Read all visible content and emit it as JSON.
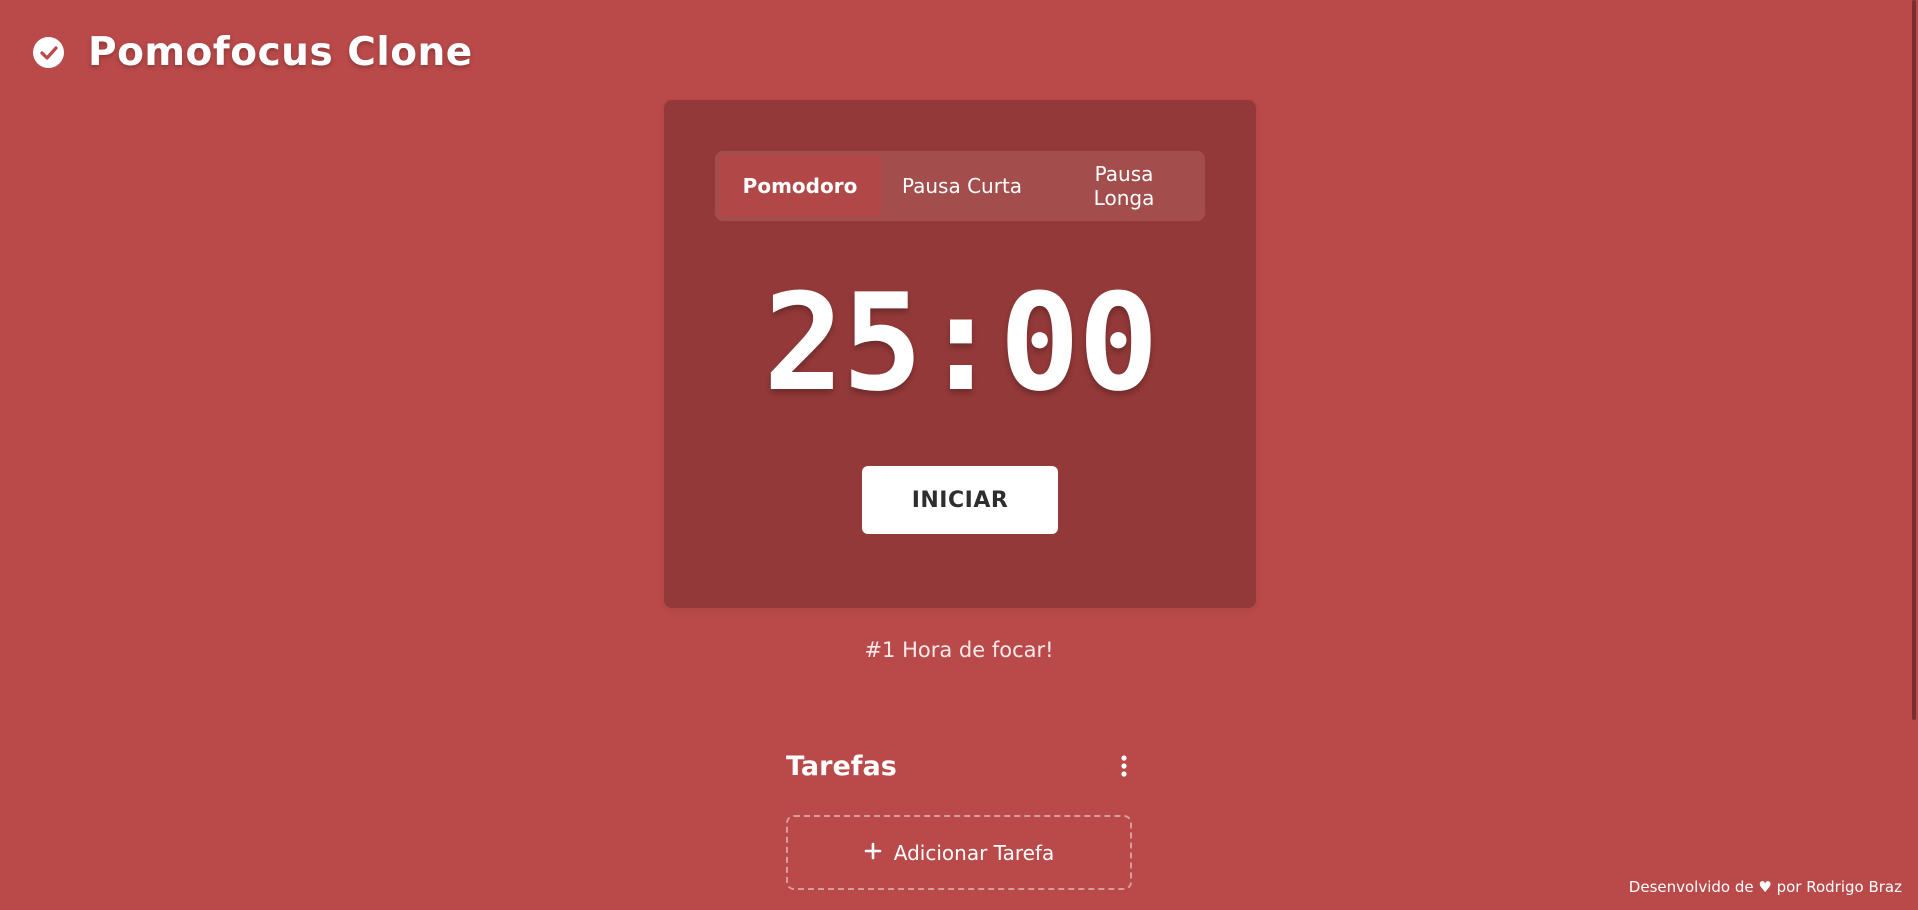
{
  "header": {
    "title": "Pomofocus Clone",
    "icon": "check-circle-icon"
  },
  "timer": {
    "tabs": [
      {
        "label": "Pomodoro",
        "active": true
      },
      {
        "label": "Pausa Curta",
        "active": false
      },
      {
        "label": "Pausa Longa",
        "active": false
      }
    ],
    "time": "25:00",
    "start_label": "INICIAR"
  },
  "message": "#1 Hora de focar!",
  "tasks": {
    "title": "Tarefas",
    "menu_icon": "vertical-ellipsis-icon",
    "add_label": "Adicionar Tarefa",
    "add_icon": "plus-icon"
  },
  "footer": {
    "text": "Desenvolvido de ♥ por Rodrigo Braz"
  },
  "colors": {
    "background": "#ba4949",
    "card": "#943939",
    "tabs_bg": "#a44d4d",
    "active_tab": "#b24747",
    "button_bg": "#ffffff",
    "button_text": "#2e2e2e"
  }
}
